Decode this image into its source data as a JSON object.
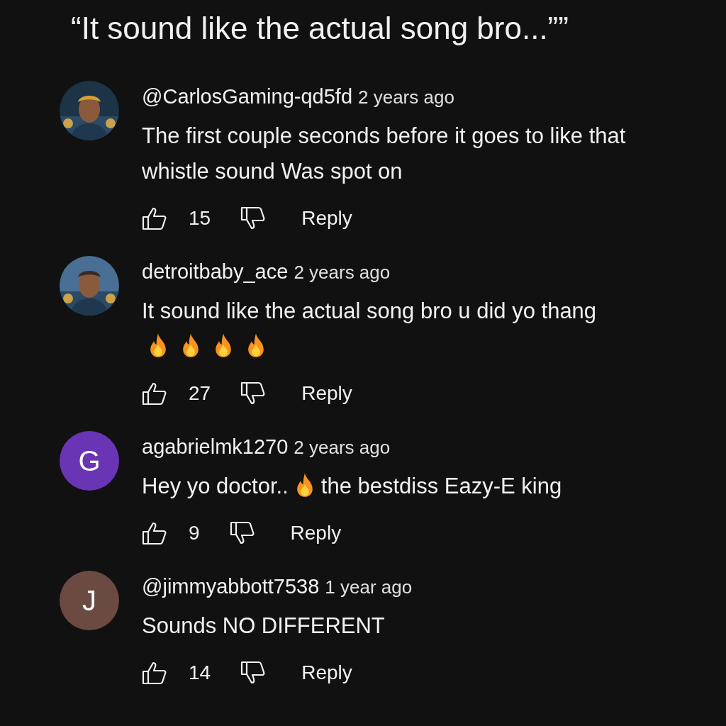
{
  "title": "“It sound like the actual song bro...””",
  "comments": [
    {
      "author": "@CarlosGaming-qd5fd",
      "time": "2 years ago",
      "body": [
        {
          "kind": "text",
          "text": "The first couple seconds before it goes to like that whistle sound Was spot on"
        }
      ],
      "likes": "15",
      "reply": "Reply"
    },
    {
      "author": "detroitbaby_ace",
      "time": "2 years ago",
      "body": [
        {
          "kind": "text",
          "text": "It sound like the actual song bro u did yo thang"
        },
        {
          "kind": "break"
        },
        {
          "kind": "flame"
        },
        {
          "kind": "flame"
        },
        {
          "kind": "flame"
        },
        {
          "kind": "flame"
        }
      ],
      "likes": "27",
      "reply": "Reply"
    },
    {
      "avatar": {
        "kind": "letter",
        "letter": "G",
        "color": "#6a35b5"
      },
      "author": "agabrielmk1270",
      "time": "2 years ago",
      "body": [
        {
          "kind": "text",
          "text": "Hey yo doctor.."
        },
        {
          "kind": "flame"
        },
        {
          "kind": "text",
          "text": "the bestdiss Eazy-E king"
        }
      ],
      "likes": "9",
      "reply": "Reply"
    },
    {
      "avatar": {
        "kind": "letter",
        "letter": "J",
        "color": "#6b4a42"
      },
      "author": "@jimmyabbott7538",
      "time": "1 year ago",
      "body": [
        {
          "kind": "text",
          "text": "Sounds NO DIFFERENT"
        }
      ],
      "likes": "14",
      "reply": "Reply"
    }
  ]
}
